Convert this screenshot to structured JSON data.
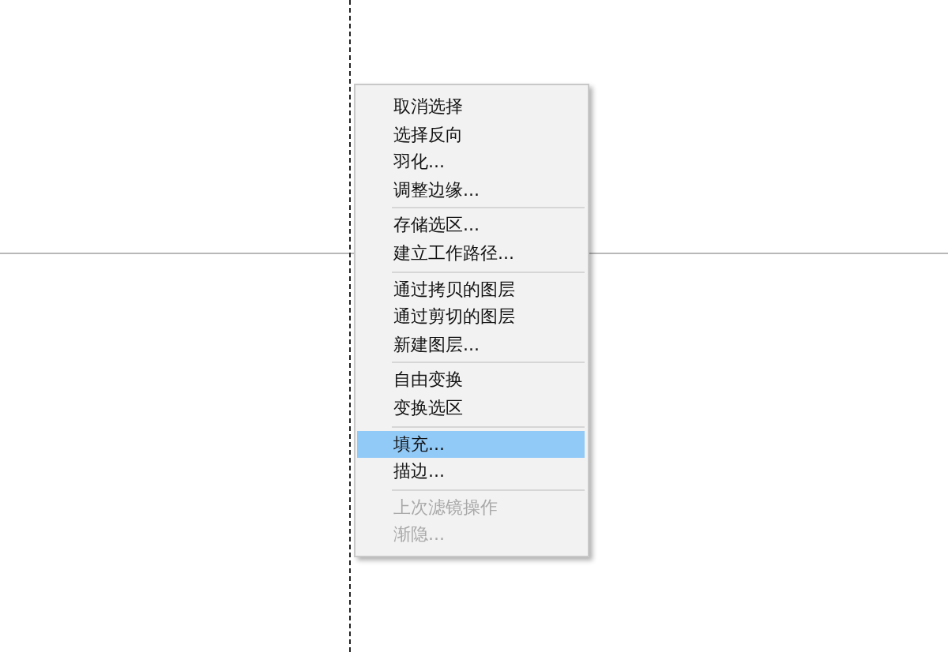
{
  "context_menu": {
    "groups": [
      {
        "items": [
          {
            "label": "取消选择",
            "selected": false,
            "disabled": false
          },
          {
            "label": "选择反向",
            "selected": false,
            "disabled": false
          },
          {
            "label": "羽化...",
            "selected": false,
            "disabled": false
          },
          {
            "label": "调整边缘...",
            "selected": false,
            "disabled": false
          }
        ]
      },
      {
        "items": [
          {
            "label": "存储选区...",
            "selected": false,
            "disabled": false
          },
          {
            "label": "建立工作路径...",
            "selected": false,
            "disabled": false
          }
        ]
      },
      {
        "items": [
          {
            "label": "通过拷贝的图层",
            "selected": false,
            "disabled": false
          },
          {
            "label": "通过剪切的图层",
            "selected": false,
            "disabled": false
          },
          {
            "label": "新建图层...",
            "selected": false,
            "disabled": false
          }
        ]
      },
      {
        "items": [
          {
            "label": "自由变换",
            "selected": false,
            "disabled": false
          },
          {
            "label": "变换选区",
            "selected": false,
            "disabled": false
          }
        ]
      },
      {
        "items": [
          {
            "label": "填充...",
            "selected": true,
            "disabled": false
          },
          {
            "label": "描边...",
            "selected": false,
            "disabled": false
          }
        ]
      },
      {
        "items": [
          {
            "label": "上次滤镜操作",
            "selected": false,
            "disabled": true
          },
          {
            "label": "渐隐...",
            "selected": false,
            "disabled": true
          }
        ]
      }
    ]
  }
}
